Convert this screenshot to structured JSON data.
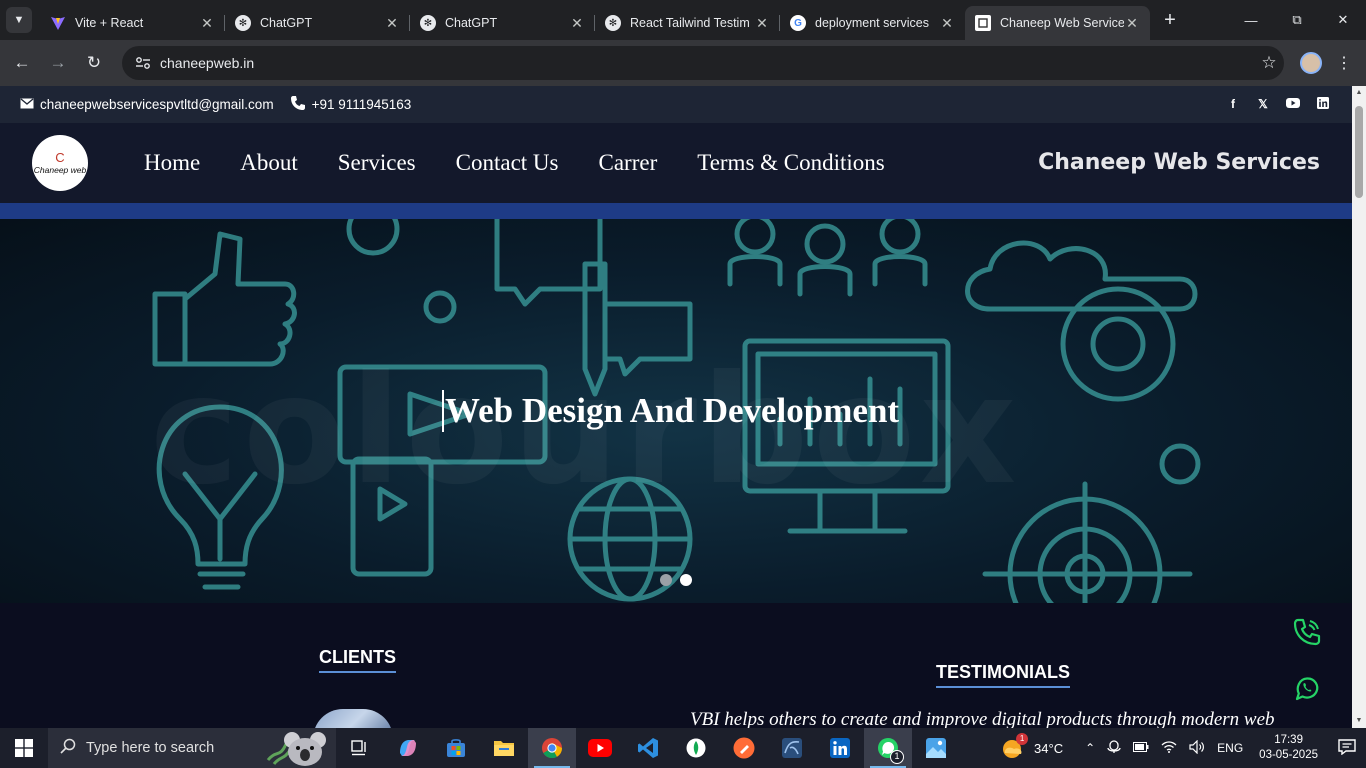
{
  "browser": {
    "tabs": [
      {
        "title": "Vite + React",
        "icon": "vite-icon",
        "active": false
      },
      {
        "title": "ChatGPT",
        "icon": "chatgpt-icon",
        "active": false
      },
      {
        "title": "ChatGPT",
        "icon": "chatgpt-icon",
        "active": false
      },
      {
        "title": "React Tailwind Testim",
        "icon": "chatgpt-icon",
        "active": false
      },
      {
        "title": "deployment services",
        "icon": "google-icon",
        "active": false
      },
      {
        "title": "Chaneep Web Service",
        "icon": "chaneep-favicon",
        "active": true
      }
    ],
    "url": "chaneepweb.in"
  },
  "topbar": {
    "email": "chaneepwebservicespvtltd@gmail.com",
    "phone": "+91 9111945163",
    "socials": [
      "facebook-icon",
      "x-icon",
      "youtube-icon",
      "linkedin-icon"
    ]
  },
  "nav": {
    "logo_mark": "C",
    "logo_text": "Chaneep web",
    "items": [
      "Home",
      "About",
      "Services",
      "Contact Us",
      "Carrer",
      "Terms & Conditions"
    ],
    "brand": "Chaneep Web Services"
  },
  "hero": {
    "title": "Web Design And Development",
    "slides_total": 2,
    "active_slide": 2
  },
  "sections": {
    "clients_heading": "CLIENTS",
    "testimonials_heading": "TESTIMONIALS",
    "testimonial_quote": "VBI helps others to create and improve digital products through modern web"
  },
  "taskbar": {
    "search_placeholder": "Type here to search",
    "temperature": "34°C",
    "language": "ENG",
    "time": "17:39",
    "date": "03-05-2025",
    "weather_badge": "1",
    "whatsapp_badge": "1"
  },
  "colors": {
    "page_bg": "#0b0d1f",
    "navbar_bg": "#13182b",
    "strip": "#1e3b86",
    "accent_underline": "#5b8fd6",
    "float_icon": "#25d366"
  }
}
